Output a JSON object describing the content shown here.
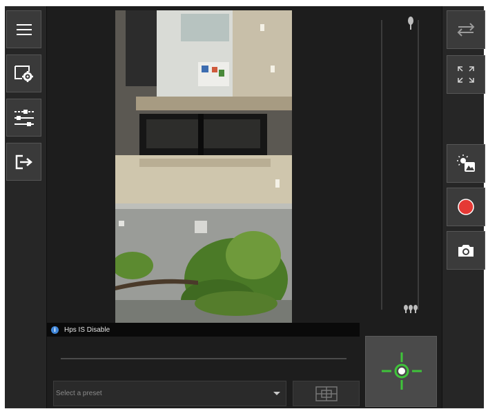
{
  "status": {
    "message": "Hps IS Disable"
  },
  "preset": {
    "placeholder": "Select a preset",
    "current_value": ""
  },
  "left_toolbar": {
    "items": [
      {
        "name": "menu",
        "icon": "hamburger-menu-icon"
      },
      {
        "name": "camera-settings",
        "icon": "display-settings-icon"
      },
      {
        "name": "adjustments",
        "icon": "sliders-icon"
      },
      {
        "name": "exit",
        "icon": "exit-arrow-icon"
      }
    ]
  },
  "right_toolbar": {
    "items": [
      {
        "name": "swap",
        "icon": "swap-arrows-icon"
      },
      {
        "name": "fullscreen",
        "icon": "fullscreen-expand-icon"
      },
      {
        "name": "image-enhance",
        "icon": "image-brightness-icon"
      },
      {
        "name": "record",
        "icon": "record-icon",
        "color": "#e53935"
      },
      {
        "name": "snapshot",
        "icon": "camera-icon"
      }
    ]
  },
  "colors": {
    "ptz_accent": "#3fc43a",
    "info_accent": "#3f86d9",
    "record": "#e53935"
  }
}
